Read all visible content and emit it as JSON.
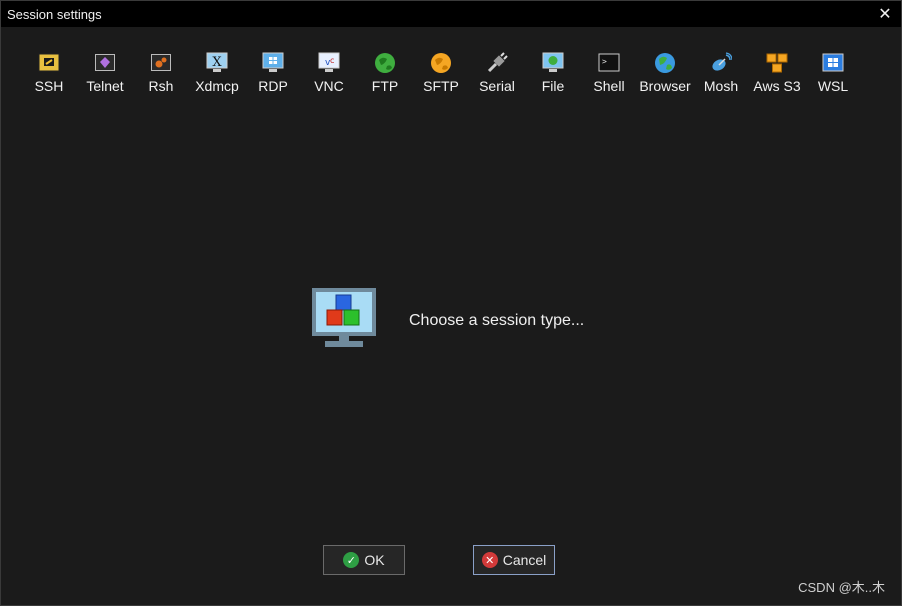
{
  "window": {
    "title": "Session settings"
  },
  "session_types": [
    {
      "label": "SSH",
      "icon": "key-icon"
    },
    {
      "label": "Telnet",
      "icon": "telnet-gem-icon"
    },
    {
      "label": "Rsh",
      "icon": "rsh-gears-icon"
    },
    {
      "label": "Xdmcp",
      "icon": "x-display-icon"
    },
    {
      "label": "RDP",
      "icon": "windows-monitor-icon"
    },
    {
      "label": "VNC",
      "icon": "vnc-monitor-icon"
    },
    {
      "label": "FTP",
      "icon": "ftp-globe-icon"
    },
    {
      "label": "SFTP",
      "icon": "sftp-globe-icon"
    },
    {
      "label": "Serial",
      "icon": "serial-plug-icon"
    },
    {
      "label": "File",
      "icon": "file-monitor-icon"
    },
    {
      "label": "Shell",
      "icon": "terminal-icon"
    },
    {
      "label": "Browser",
      "icon": "browser-globe-icon"
    },
    {
      "label": "Mosh",
      "icon": "satellite-dish-icon"
    },
    {
      "label": "Aws S3",
      "icon": "aws-cubes-icon"
    },
    {
      "label": "WSL",
      "icon": "windows-logo-icon"
    }
  ],
  "main": {
    "prompt": "Choose a session type..."
  },
  "buttons": {
    "ok": "OK",
    "cancel": "Cancel"
  },
  "watermark": "CSDN @木..木",
  "colors": {
    "background": "#1b1b1b",
    "titlebar": "#000000",
    "ok_green": "#2e9e44",
    "cancel_red": "#d23a3a",
    "cancel_border": "#8aa0c8"
  }
}
